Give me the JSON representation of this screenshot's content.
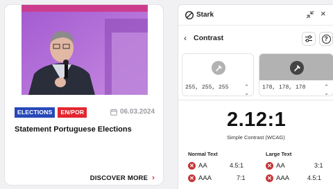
{
  "card": {
    "tags": [
      {
        "label": "ELECTIONS",
        "color": "#2749b8"
      },
      {
        "label": "EN/POR",
        "color": "#e3262f"
      }
    ],
    "date": "06.03.2024",
    "headline": "Statement Portuguese Elections",
    "cta_label": "DISCOVER MORE",
    "cta_chevron": "›"
  },
  "stark": {
    "app_title": "Stark",
    "nav_title": "Contrast",
    "foreground": {
      "value": "255, 255, 255",
      "hex": "#ffffff"
    },
    "background": {
      "value": "178, 178, 178",
      "hex": "#b2b2b2"
    },
    "ratio": "2.12:1",
    "ratio_label": "Simple Contrast (WCAG)",
    "normal_text": {
      "heading": "Normal Text",
      "rows": [
        {
          "level": "AA",
          "required": "4.5:1",
          "status": "fail"
        },
        {
          "level": "AAA",
          "required": "7:1",
          "status": "fail"
        }
      ]
    },
    "large_text": {
      "heading": "Large Text",
      "rows": [
        {
          "level": "AA",
          "required": "3:1",
          "status": "fail"
        },
        {
          "level": "AAA",
          "required": "4.5:1",
          "status": "fail"
        }
      ]
    },
    "icons": [
      "stark-logo-icon",
      "collapse-icon",
      "close-icon",
      "chevron-left-icon",
      "sliders-icon",
      "help-icon",
      "eyedropper-icon",
      "fail-icon"
    ]
  },
  "colors": {
    "accent_red": "#e3262f",
    "accent_blue": "#2749b8",
    "fail_red": "#c4363a",
    "photo_purple": "#b26ad6"
  }
}
